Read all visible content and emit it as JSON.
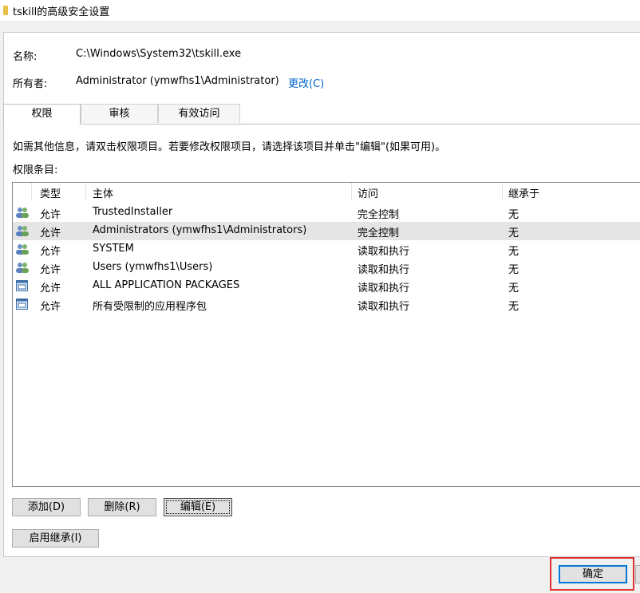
{
  "window": {
    "title": "tskill的高级安全设置"
  },
  "fields": {
    "name_label": "名称:",
    "name_value": "C:\\Windows\\System32\\tskill.exe",
    "owner_label": "所有者:",
    "owner_value": "Administrator (ymwfhs1\\Administrator)",
    "owner_change": "更改(C)"
  },
  "tabs": [
    {
      "label": "权限",
      "active": true
    },
    {
      "label": "审核",
      "active": false
    },
    {
      "label": "有效访问",
      "active": false
    }
  ],
  "info_text": "如需其他信息，请双击权限项目。若要修改权限项目，请选择该项目并单击\"编辑\"(如果可用)。",
  "perm_label": "权限条目:",
  "table": {
    "headers": [
      "类型",
      "主体",
      "访问",
      "继承于"
    ],
    "rows": [
      {
        "icon": "user-group-icon",
        "type": "允许",
        "principal": "TrustedInstaller",
        "access": "完全控制",
        "inherit": "无",
        "selected": false
      },
      {
        "icon": "user-group-icon",
        "type": "允许",
        "principal": "Administrators (ymwfhs1\\Administrators)",
        "access": "完全控制",
        "inherit": "无",
        "selected": true
      },
      {
        "icon": "user-group-icon",
        "type": "允许",
        "principal": "SYSTEM",
        "access": "读取和执行",
        "inherit": "无",
        "selected": false
      },
      {
        "icon": "user-group-icon",
        "type": "允许",
        "principal": "Users (ymwfhs1\\Users)",
        "access": "读取和执行",
        "inherit": "无",
        "selected": false
      },
      {
        "icon": "app-package-icon",
        "type": "允许",
        "principal": "ALL APPLICATION PACKAGES",
        "access": "读取和执行",
        "inherit": "无",
        "selected": false
      },
      {
        "icon": "app-package-icon",
        "type": "允许",
        "principal": "所有受限制的应用程序包",
        "access": "读取和执行",
        "inherit": "无",
        "selected": false
      }
    ]
  },
  "buttons": {
    "add": "添加(D)",
    "remove": "删除(R)",
    "edit": "编辑(E)",
    "enable_inheritance": "启用继承(I)",
    "ok": "确定"
  },
  "colors": {
    "link": "#0066cc",
    "highlight": "#e03030",
    "primary_border": "#0078d7"
  }
}
